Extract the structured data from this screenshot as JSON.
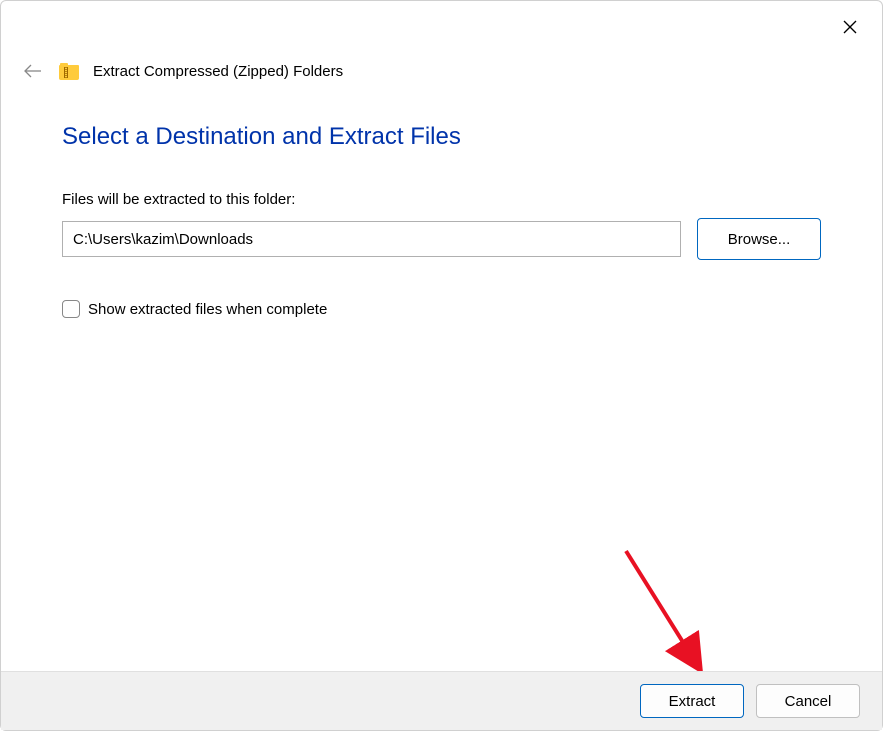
{
  "header": {
    "title": "Extract Compressed (Zipped) Folders"
  },
  "main": {
    "heading": "Select a Destination and Extract Files",
    "field_label": "Files will be extracted to this folder:",
    "path_value": "C:\\Users\\kazim\\Downloads",
    "browse_label": "Browse...",
    "checkbox_label": "Show extracted files when complete"
  },
  "footer": {
    "extract_label": "Extract",
    "cancel_label": "Cancel"
  }
}
